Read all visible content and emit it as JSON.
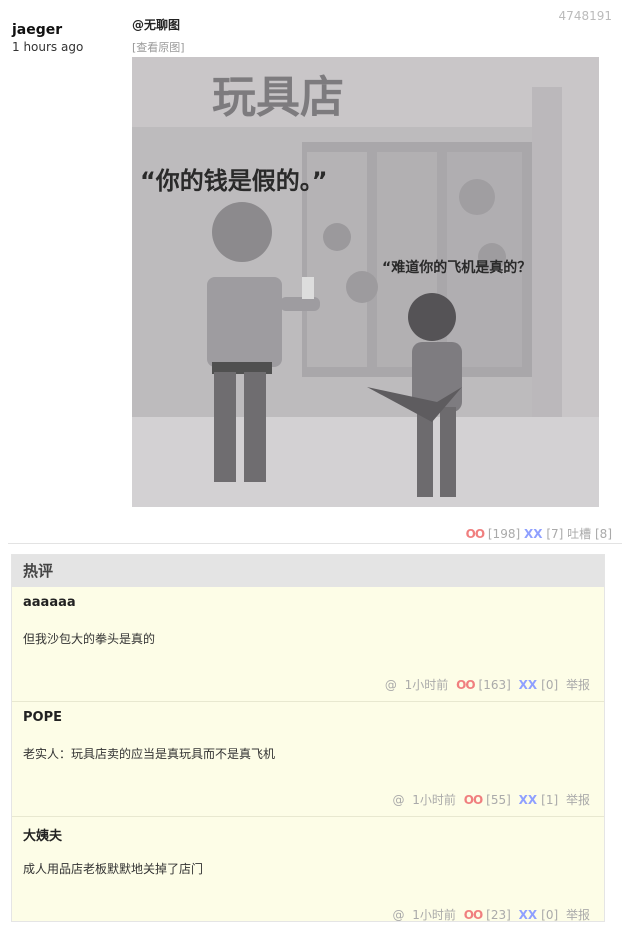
{
  "post": {
    "author": "jaeger",
    "time": "1 hours ago",
    "id": "4748191",
    "tag": "@无聊图",
    "view_original": "[查看原图]",
    "image": {
      "shop_sign": "玩具店",
      "speech_man": "“你的钱是假的。”",
      "speech_boy": "“难道你的飞机是真的？"
    },
    "votes": {
      "oo_label": "OO",
      "oo_count": "[198]",
      "xx_label": "XX",
      "xx_count": "[7]",
      "tucao_label": "吐槽",
      "tucao_count": "[8]"
    }
  },
  "hot": {
    "title": "热评",
    "comments": [
      {
        "name": "aaaaaa",
        "text": "但我沙包大的拳头是真的",
        "at": "@",
        "time": "1小时前",
        "oo": "OO",
        "oo_count": "[163]",
        "xx": "XX",
        "xx_count": "[0]",
        "report": "举报"
      },
      {
        "name": "POPE",
        "text": "老实人：玩具店卖的应当是真玩具而不是真飞机",
        "at": "@",
        "time": "1小时前",
        "oo": "OO",
        "oo_count": "[55]",
        "xx": "XX",
        "xx_count": "[1]",
        "report": "举报"
      },
      {
        "name": "大姨夫",
        "text": "成人用品店老板默默地关掉了店门",
        "at": "@",
        "time": "1小时前",
        "oo": "OO",
        "oo_count": "[23]",
        "xx": "XX",
        "xx_count": "[0]",
        "report": "举报"
      }
    ]
  }
}
